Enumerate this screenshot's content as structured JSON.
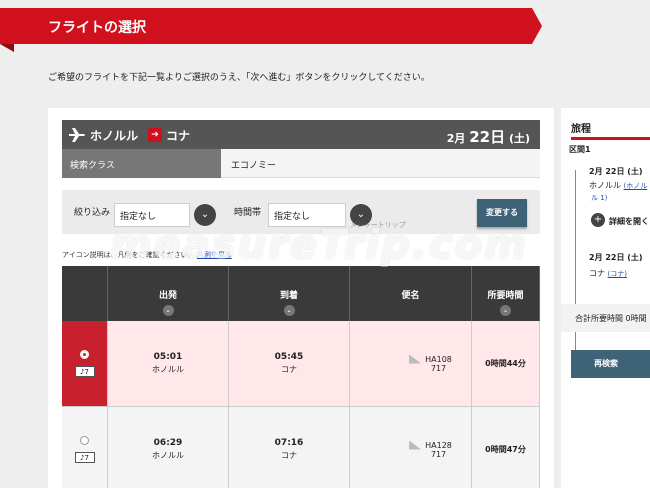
{
  "header": {
    "title": "フライトの選択"
  },
  "instruction": "ご希望のフライトを下記一覧よりご選択のうえ、「次へ進む」ボタンをクリックしてください。",
  "route": {
    "from": "ホノルル",
    "to": "コナ",
    "date_month": "2月",
    "date_day": "22日",
    "date_weekday": "(土)"
  },
  "class": {
    "label": "検索クラス",
    "value": "エコノミー"
  },
  "filters": {
    "narrow_label": "絞り込み",
    "narrow_value": "指定なし",
    "timeslot_label": "時間帯",
    "timeslot_value": "指定なし",
    "change_button": "変更する"
  },
  "icon_note": {
    "text": "アイコン説明は、凡例をご確認ください。",
    "link": "凡例を見る"
  },
  "table": {
    "headers": [
      "出発",
      "到着",
      "便名",
      "所要時間"
    ],
    "rows": [
      {
        "seat": "7",
        "dep_time": "05:01",
        "dep_city": "ホノルル",
        "arr_time": "05:45",
        "arr_city": "コナ",
        "flight_no": "HA108",
        "aircraft": "717",
        "duration": "0時間44分",
        "selected": true
      },
      {
        "seat": "7",
        "dep_time": "06:29",
        "dep_city": "ホノルル",
        "arr_time": "07:16",
        "arr_city": "コナ",
        "flight_no": "HA128",
        "aircraft": "717",
        "duration": "0時間47分",
        "selected": false
      }
    ]
  },
  "itinerary": {
    "title": "旅程",
    "section": "区間1",
    "dep_date": "2月 22日 (土)",
    "dep_city": "ホノルル",
    "dep_link": "(ホノル",
    "dep_link2": "ル 1)",
    "detail": "詳細を開く",
    "arr_date": "2月 22日 (土)",
    "arr_city": "コナ",
    "arr_link": "(コナ)",
    "total": "合計所要時間 0時間",
    "research_button": "再検索"
  },
  "watermark": {
    "main": "measureTrip.com",
    "sub": "メジャートリップ"
  },
  "colors": {
    "brand_red": "#d0101c",
    "dark_header": "#3a3a3a",
    "action_blue": "#3e6276"
  }
}
